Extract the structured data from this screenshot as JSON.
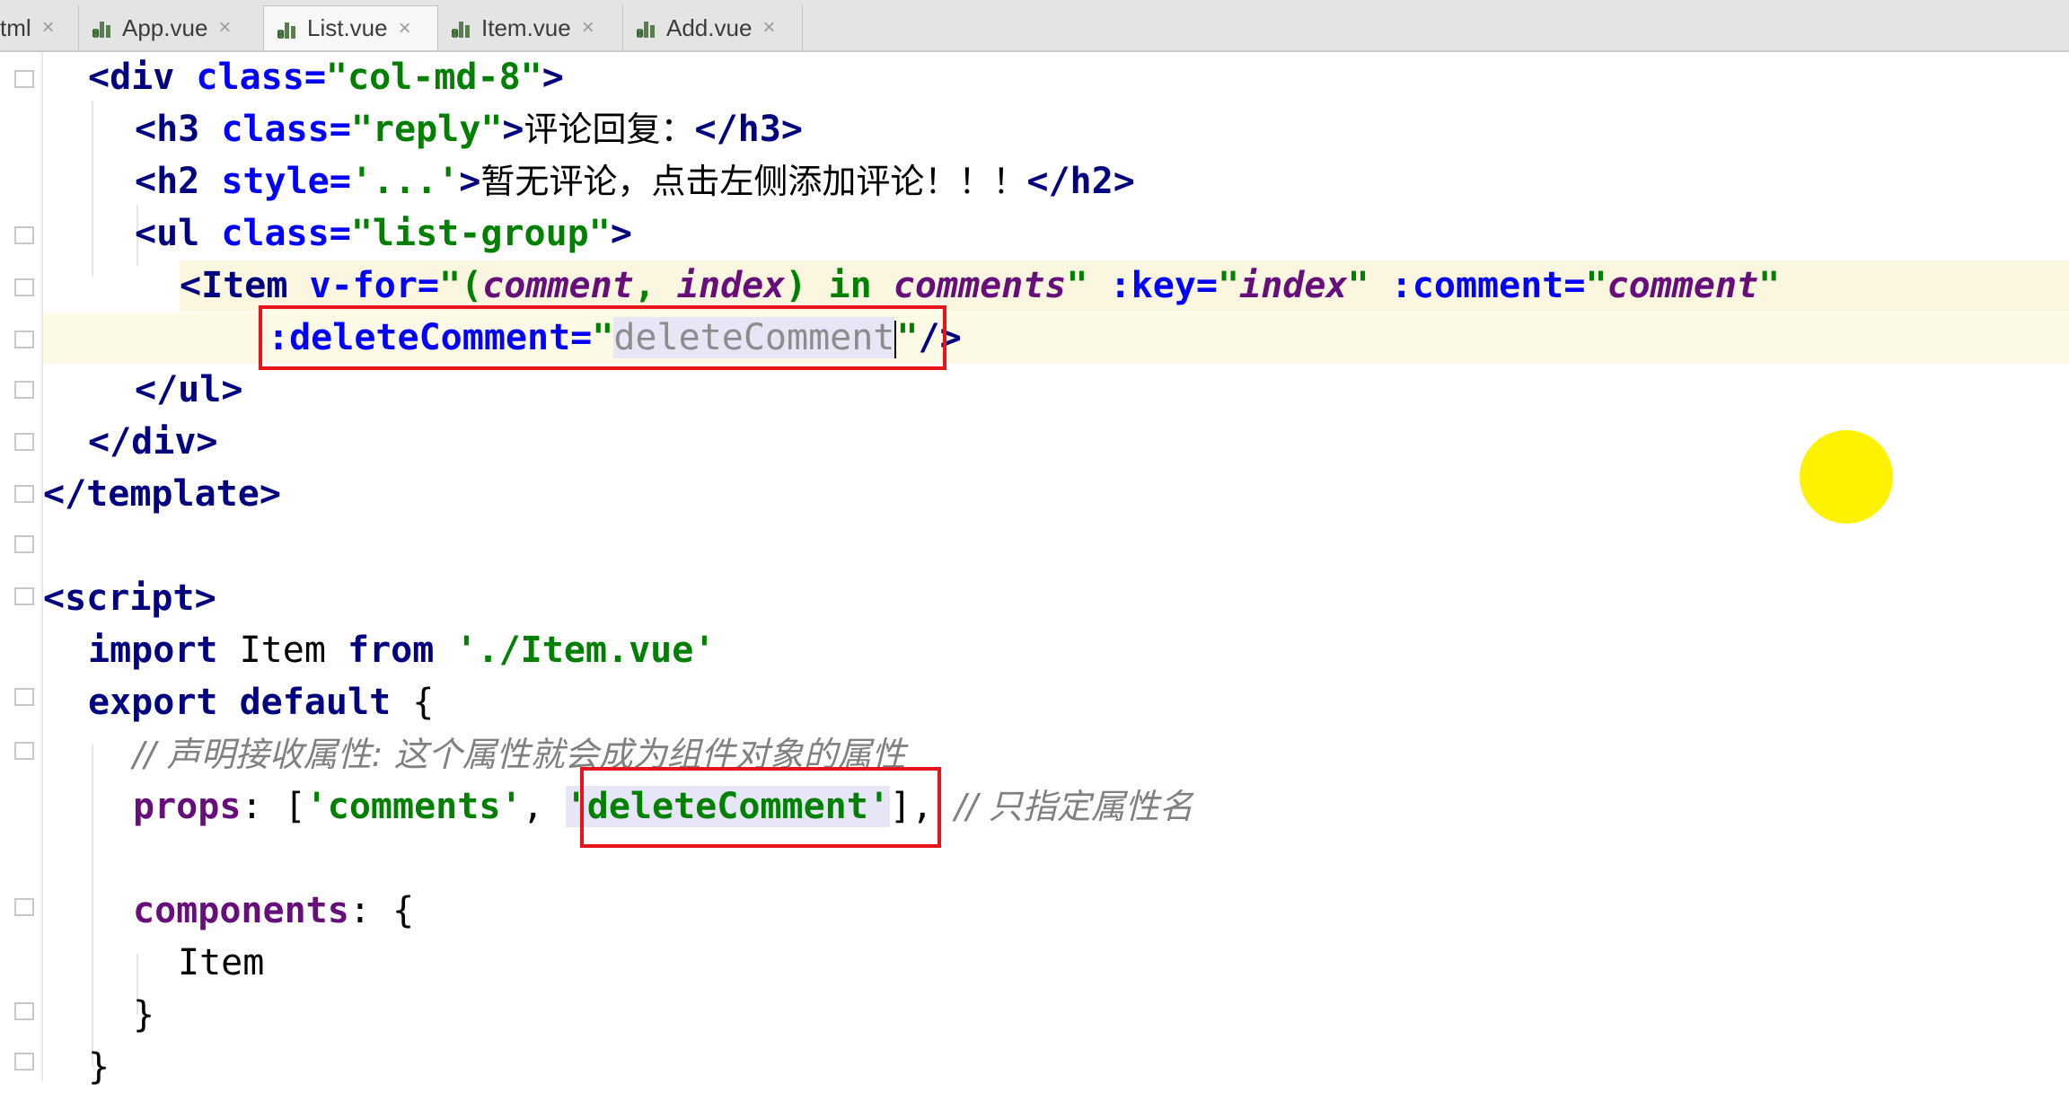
{
  "tabs": [
    {
      "label": "tml",
      "active": false,
      "icon": "html-file-icon"
    },
    {
      "label": "App.vue",
      "active": false,
      "icon": "vue-file-icon"
    },
    {
      "label": "List.vue",
      "active": true,
      "icon": "vue-file-icon"
    },
    {
      "label": "Item.vue",
      "active": false,
      "icon": "vue-file-icon"
    },
    {
      "label": "Add.vue",
      "active": false,
      "icon": "vue-file-icon"
    }
  ],
  "close_glyph": "×",
  "code": {
    "l1": {
      "a": "<div ",
      "b": "class=",
      "c": "\"col-md-8\"",
      "d": ">"
    },
    "l2": {
      "a": "<h3 ",
      "b": "class=",
      "c": "\"reply\"",
      "d": ">",
      "e": "评论回复：",
      "f": "</h3>"
    },
    "l3": {
      "a": "<h2 ",
      "b": "style=",
      "c": "'...'",
      "d": ">",
      "e": "暂无评论，点击左侧添加评论！！！",
      "f": "</h2>"
    },
    "l4": {
      "a": "<ul ",
      "b": "class=",
      "c": "\"list-group\"",
      "d": ">"
    },
    "l5": {
      "a": "<Item ",
      "b": "v-for=",
      "c": "\"(",
      "d": "comment",
      "e": ", ",
      "f": "index",
      "g": ") in ",
      "h": "comments",
      "i": "\" ",
      "j": ":key=",
      "k": "\"",
      "l": "index",
      "m": "\" ",
      "n": ":comment=",
      "o": "\"",
      "p": "comment",
      "q": "\""
    },
    "l6": {
      "a": ":deleteComment=",
      "b": "\"",
      "c": "deleteComment",
      "d": "\"",
      "e": "/>"
    },
    "l7": {
      "a": "</ul>"
    },
    "l8": {
      "a": "</div>"
    },
    "l9": {
      "a": "</template>"
    },
    "l11": {
      "a": "<script>"
    },
    "l12": {
      "a": "import ",
      "b": "Item ",
      "c": "from ",
      "d": "'./Item.vue'"
    },
    "l13": {
      "a": "export default ",
      "b": "{"
    },
    "l14": {
      "a": "// 声明接收属性: 这个属性就会成为组件对象的属性"
    },
    "l15": {
      "a": "props",
      "b": ": [",
      "c": "'comments'",
      "d": ", ",
      "e": "'deleteComment'",
      "f": "], ",
      "g": "// 只指定属性名"
    },
    "l17": {
      "a": "components",
      "b": ": {"
    },
    "l18": {
      "a": "Item"
    },
    "l19": {
      "a": "}"
    },
    "l20": {
      "a": "}"
    }
  },
  "colors": {
    "tag": "#000080",
    "attribute": "#0000ff",
    "string": "#008000",
    "highlight_box": "#e8141c",
    "cursor_dot": "#fff200"
  }
}
